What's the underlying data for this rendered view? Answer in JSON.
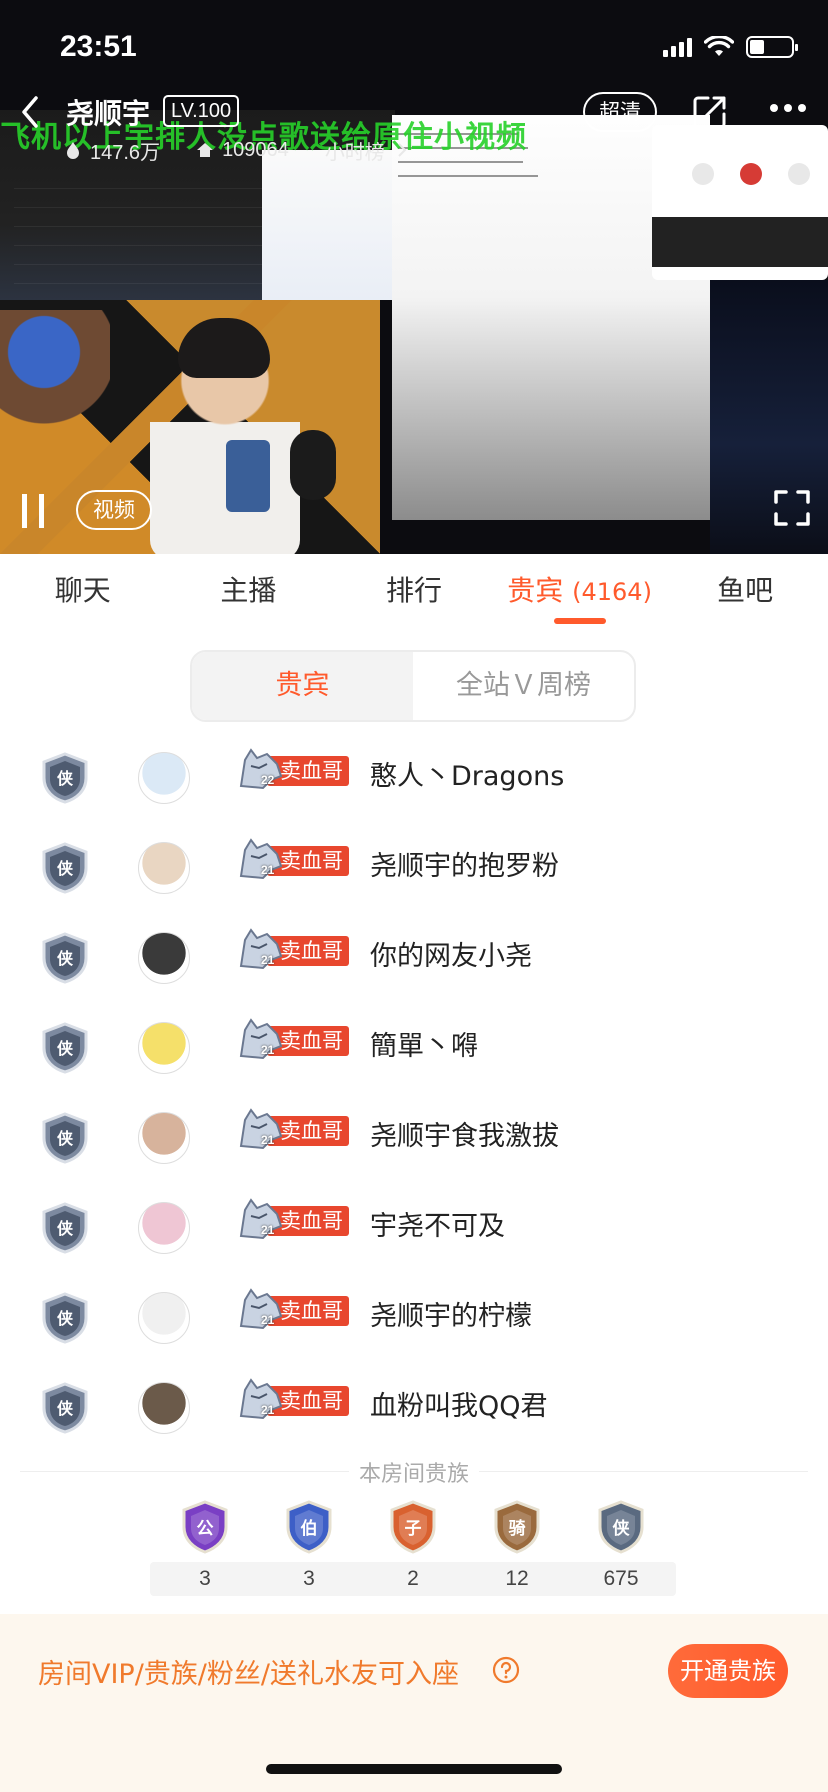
{
  "status_bar": {
    "time": "23:51"
  },
  "header": {
    "streamer_name": "尧顺宇",
    "level": "LV.100",
    "quality": "超清",
    "popularity": "147.6万",
    "followers": "109064",
    "rank_label": "小时榜"
  },
  "video": {
    "tag": "视频",
    "overlay_text": "飞机以上宇排人没点歌送给原住小视频"
  },
  "tabs": [
    {
      "label": "聊天"
    },
    {
      "label": "主播"
    },
    {
      "label": "排行"
    },
    {
      "label": "贵宾",
      "count": "(4164)"
    },
    {
      "label": "鱼吧"
    }
  ],
  "segments": [
    {
      "label": "贵宾"
    },
    {
      "label": "全站Ｖ周榜"
    }
  ],
  "vip_list": [
    {
      "name": "憨人丶Dragons",
      "fan_badge": "卖血哥",
      "badge_level": "22",
      "rank": "侠"
    },
    {
      "name": "尧顺宇的抱罗粉",
      "fan_badge": "卖血哥",
      "badge_level": "21",
      "rank": "侠"
    },
    {
      "name": "你的网友小尧",
      "fan_badge": "卖血哥",
      "badge_level": "21",
      "rank": "侠"
    },
    {
      "name": "簡單丶嘚",
      "fan_badge": "卖血哥",
      "badge_level": "21",
      "rank": "侠"
    },
    {
      "name": "尧顺宇食我激拔",
      "fan_badge": "卖血哥",
      "badge_level": "21",
      "rank": "侠"
    },
    {
      "name": "宇尧不可及",
      "fan_badge": "卖血哥",
      "badge_level": "21",
      "rank": "侠"
    },
    {
      "name": "尧顺宇的柠檬",
      "fan_badge": "卖血哥",
      "badge_level": "21",
      "rank": "侠"
    },
    {
      "name": "血粉叫我QQ君",
      "fan_badge": "卖血哥",
      "badge_level": "21",
      "rank": "侠"
    }
  ],
  "nobility": {
    "title": "本房间贵族",
    "items": [
      {
        "rank": "公",
        "count": "3",
        "color": "#7a3fc4"
      },
      {
        "rank": "伯",
        "count": "3",
        "color": "#3d5fc7"
      },
      {
        "rank": "子",
        "count": "2",
        "color": "#d9612f"
      },
      {
        "rank": "骑",
        "count": "12",
        "color": "#9a6a3d"
      },
      {
        "rank": "侠",
        "count": "675",
        "color": "#5a6a80"
      }
    ]
  },
  "footer": {
    "text": "房间VIP/贵族/粉丝/送礼水友可入座",
    "button": "开通贵族"
  },
  "colors": {
    "accent": "#ff5a2c",
    "banner_bg": "#fdf7ee"
  }
}
